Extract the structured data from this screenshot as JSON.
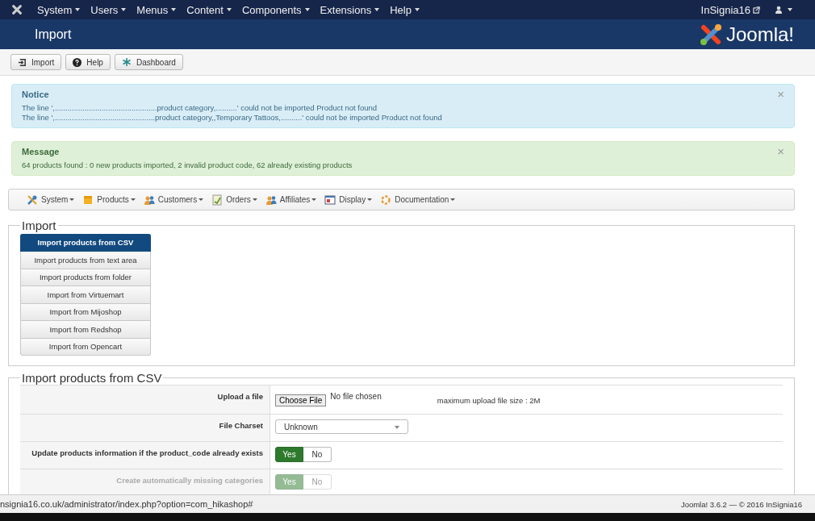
{
  "topnav": {
    "menus": [
      "System",
      "Users",
      "Menus",
      "Content",
      "Components",
      "Extensions",
      "Help"
    ],
    "site": "InSignia16"
  },
  "header": {
    "title": "Import",
    "logo_text": "Joomla!"
  },
  "toolbar": [
    {
      "label": "Import"
    },
    {
      "label": "Help"
    },
    {
      "label": "Dashboard"
    }
  ],
  "alerts": [
    {
      "kind": "notice",
      "title": "Notice",
      "close": "×",
      "lines": [
        "The line ',................................................product category,..........' could not be imported Product not found",
        "The line ',...............................................product category,,Temporary Tattoos,..........' could not be imported Product not found"
      ]
    },
    {
      "kind": "message",
      "title": "Message",
      "close": "×",
      "lines": [
        "64 products found : 0 new products imported, 2 invalid product code, 62 already existing products"
      ]
    }
  ],
  "submenu": [
    {
      "label": "System"
    },
    {
      "label": "Products"
    },
    {
      "label": "Customers"
    },
    {
      "label": "Orders"
    },
    {
      "label": "Affiliates"
    },
    {
      "label": "Display"
    },
    {
      "label": "Documentation"
    }
  ],
  "import_section": {
    "legend": "Import",
    "options": [
      {
        "label": "Import products from CSV",
        "selected": true
      },
      {
        "label": "Import products from text area",
        "selected": false
      },
      {
        "label": "Import products from folder",
        "selected": false
      },
      {
        "label": "Import from Virtuemart",
        "selected": false
      },
      {
        "label": "Import from Mijoshop",
        "selected": false
      },
      {
        "label": "Import from Redshop",
        "selected": false
      },
      {
        "label": "Import from Opencart",
        "selected": false
      }
    ]
  },
  "csv_section": {
    "legend": "Import products from CSV",
    "rows": [
      {
        "kind": "file",
        "label": "Upload a file",
        "button": "Choose File",
        "status": "No file chosen",
        "hint": "maximum upload file size : 2M"
      },
      {
        "kind": "select",
        "label": "File Charset",
        "value": "Unknown"
      },
      {
        "kind": "toggle",
        "label": "Update products information if the product_code already exists",
        "disabled": false,
        "options": [
          {
            "label": "Yes",
            "selected": true
          },
          {
            "label": "No",
            "selected": false
          }
        ]
      },
      {
        "kind": "toggle",
        "label": "Create automatically missing categories",
        "disabled": true,
        "options": [
          {
            "label": "Yes",
            "selected": true
          },
          {
            "label": "No",
            "selected": false
          }
        ]
      }
    ]
  },
  "status_url": "nsignia16.co.uk/administrator/index.php?option=com_hikashop#",
  "footer": "Joomla! 3.6.2 — © 2016 InSignia16"
}
